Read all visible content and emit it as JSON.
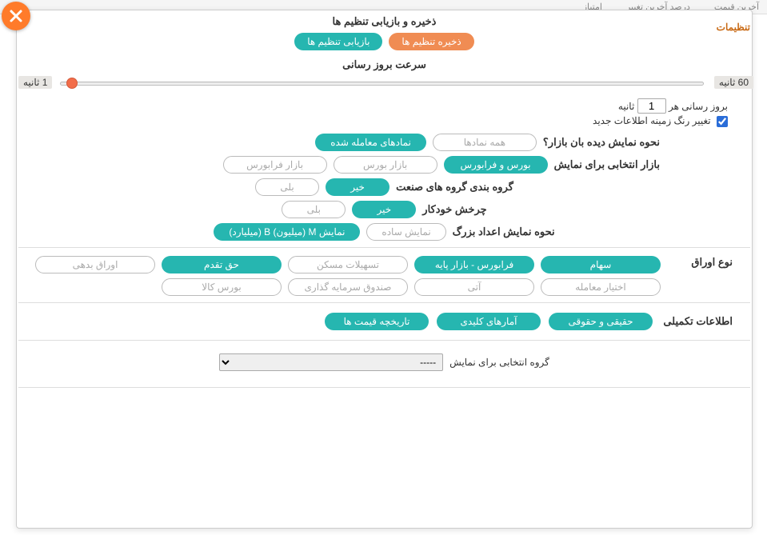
{
  "header_tabs": [
    "آخرین قیمت",
    "درصد آخرین تغییر",
    "امتیاز"
  ],
  "modal_title": "تنظیمات",
  "save_load": {
    "title": "ذخیره و بازیابی تنظیم ها",
    "save_btn": "ذخیره تنظیم ها",
    "load_btn": "بازیابی تنظیم ها"
  },
  "refresh": {
    "title": "سرعت بروز رسانی",
    "min_label": "1 ثانیه",
    "max_label": "60 ثانیه",
    "prefix": "بروز رسانی هر",
    "value": "1",
    "suffix": "ثانیه"
  },
  "color_change": {
    "label": "تغییر رنگ زمینه اطلاعات جدید"
  },
  "display_mode": {
    "label": "نحوه نمایش دیده بان بازار؟",
    "opt_all": "همه نمادها",
    "opt_traded": "نمادهای معامله شده"
  },
  "market_select": {
    "label": "بازار انتخابی برای نمایش",
    "opt_both": "بورس و فرابورس",
    "opt_bourse": "بازار بورس",
    "opt_fara": "بازار فرابورس"
  },
  "industry_group": {
    "label": "گروه بندی گروه های صنعت",
    "opt_no": "خیر",
    "opt_yes": "بلی"
  },
  "auto_scroll": {
    "label": "چرخش خودکار",
    "opt_no": "خیر",
    "opt_yes": "بلی"
  },
  "big_numbers": {
    "label": "نحوه نمایش اعداد بزرگ",
    "opt_simple": "نمایش ساده",
    "opt_mb": "نمایش M (میلیون) B (میلیارد)"
  },
  "securities": {
    "label": "نوع اوراق",
    "r1": [
      "سهام",
      "فرابورس - بازار پایه",
      "تسهیلات مسکن",
      "حق تقدم",
      "اوراق بدهی"
    ],
    "r2": [
      "اختیار معامله",
      "آتی",
      "صندوق سرمایه گذاری",
      "بورس کالا"
    ]
  },
  "extra_info": {
    "label": "اطلاعات تکمیلی",
    "opt1": "حقیقی و حقوقی",
    "opt2": "آمارهای کلیدی",
    "opt3": "تاریخچه قیمت ها"
  },
  "group_select": {
    "label": "گروه انتخابی برای نمایش",
    "selected": "-----"
  }
}
